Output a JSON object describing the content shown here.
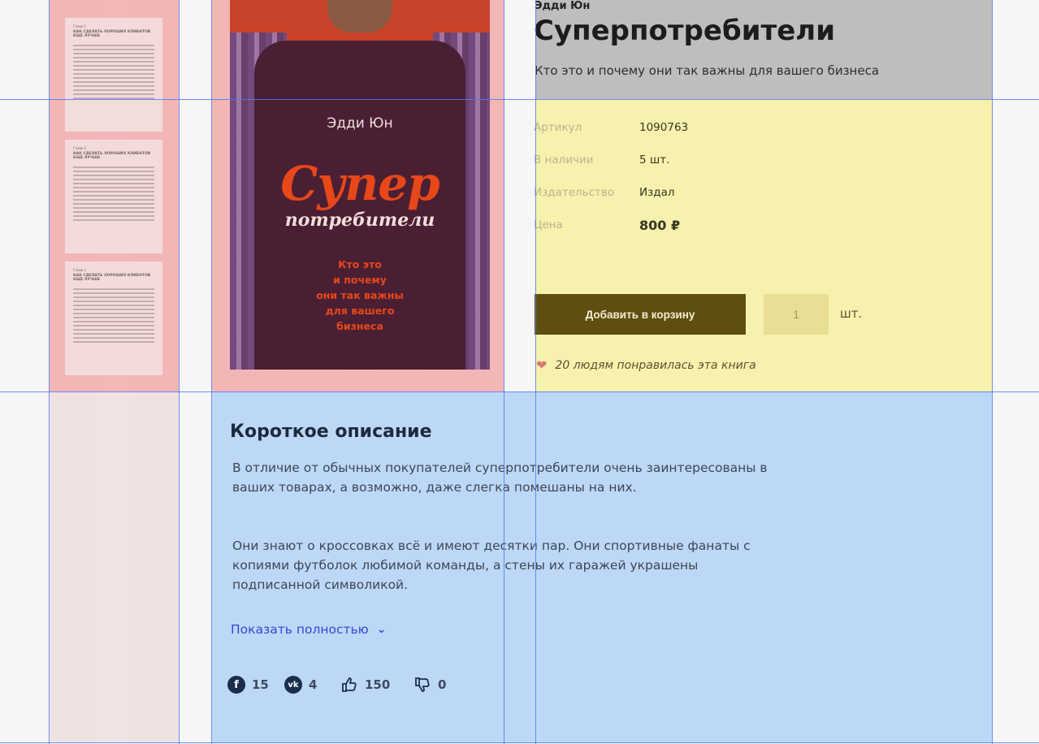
{
  "colors": {
    "accent_button": "#5e4f10",
    "link": "#3149d8",
    "heart": "#d9776f",
    "title": "#1b2a3d"
  },
  "preview_pages": [
    {
      "chapter": "Глава 1",
      "heading": "КАК СДЕЛАТЬ ХОРОШИХ КЛИЕНТОВ ЕЩЁ ЛУЧШЕ"
    },
    {
      "chapter": "Глава 1",
      "heading": "КАК СДЕЛАТЬ ХОРОШИХ КЛИЕНТОВ ЕЩЁ ЛУЧШЕ"
    },
    {
      "chapter": "Глава 1",
      "heading": "КАК СДЕЛАТЬ ХОРОШИХ КЛИЕНТОВ ЕЩЁ ЛУЧШЕ"
    }
  ],
  "cover": {
    "author": "Эдди Юн",
    "title_line1": "Супер",
    "title_line2": "потребители",
    "subtitle_lines": [
      "Кто это",
      "и почему",
      "они так важны",
      "для вашего",
      "бизнеса"
    ]
  },
  "book": {
    "author": "Эдди Юн",
    "title": "Суперпотребители",
    "subtitle": "Кто это и почему они так важны для вашего бизнеса"
  },
  "specs": [
    {
      "label": "Артикул",
      "value": "1090763"
    },
    {
      "label": "В наличии",
      "value": "5 шт."
    },
    {
      "label": "Издательство",
      "value": "Издал"
    },
    {
      "label": "Цена",
      "value": "800 ₽"
    }
  ],
  "cart": {
    "button_label": "Добавить в корзину",
    "quantity": "1",
    "unit": "шт."
  },
  "likes_text": "20 людям понравилась эта книга",
  "description": {
    "title": "Короткое описание",
    "paragraphs": [
      "В отличие от обычных покупателей суперпотребители очень заинтересованы в ваших товарах, а возможно, даже слегка помешаны на них.",
      "Они знают о кроссовках всё и имеют десятки пар. Они спортивные фанаты с копиями футболок любимой команды, а стены их гаражей украшены подписанной символикой."
    ],
    "show_more": "Показать полностью"
  },
  "social": {
    "facebook": "15",
    "vk": "4",
    "thumbs_up": "150",
    "thumbs_down": "0"
  }
}
